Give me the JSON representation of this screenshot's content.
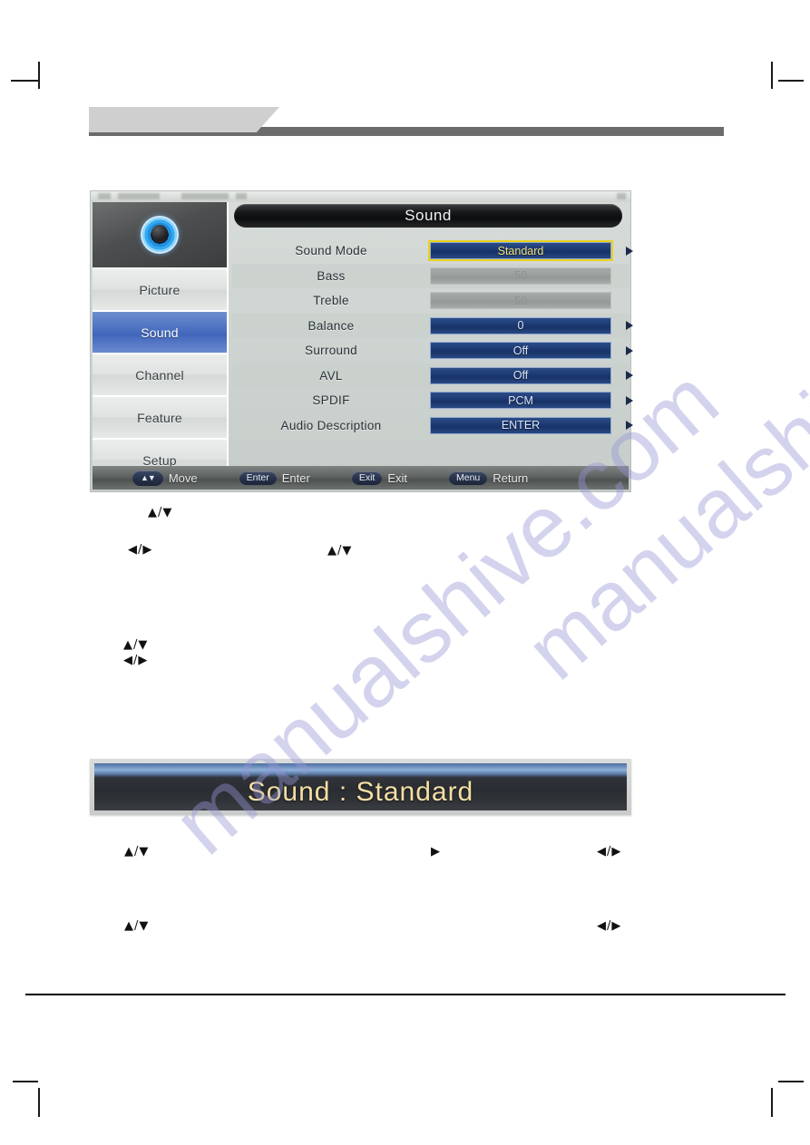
{
  "page": {
    "watermark": "manualshive.com"
  },
  "osd": {
    "title": "Sound",
    "sidebar": {
      "icon": "speaker-ring-icon",
      "items": [
        {
          "label": "Picture",
          "active": false
        },
        {
          "label": "Sound",
          "active": true
        },
        {
          "label": "Channel",
          "active": false
        },
        {
          "label": "Feature",
          "active": false
        },
        {
          "label": "Setup",
          "active": false
        }
      ]
    },
    "rows": [
      {
        "label": "Sound  Mode",
        "value": "Standard",
        "style": "selected",
        "arrow": true
      },
      {
        "label": "Bass",
        "value": "50",
        "style": "disabled",
        "arrow": false
      },
      {
        "label": "Treble",
        "value": "50",
        "style": "disabled",
        "arrow": false
      },
      {
        "label": "Balance",
        "value": "0",
        "style": "normal",
        "arrow": true
      },
      {
        "label": "Surround",
        "value": "Off",
        "style": "normal",
        "arrow": true
      },
      {
        "label": "AVL",
        "value": "Off",
        "style": "normal",
        "arrow": true
      },
      {
        "label": "SPDIF",
        "value": "PCM",
        "style": "normal",
        "arrow": true
      },
      {
        "label": "Audio  Description",
        "value": "ENTER",
        "style": "normal",
        "arrow": true
      }
    ],
    "hints": [
      {
        "key": "▲▼",
        "label": "Move"
      },
      {
        "key": "Enter",
        "label": "Enter"
      },
      {
        "key": "Exit",
        "label": "Exit"
      },
      {
        "key": "Menu",
        "label": "Return"
      }
    ]
  },
  "banner": {
    "text": "Sound  :  Standard"
  },
  "glyphs": {
    "g1": "▲/▼",
    "g2": "◀/▶",
    "g3": "▲/▼",
    "g4": "▲/▼",
    "g5": "◀/▶",
    "g6": "▲/▼",
    "g7": "▶",
    "g8": "◀/▶",
    "g9": "▲/▼",
    "g10": "◀/▶"
  },
  "colors": {
    "accent_blue": "#1d3a74",
    "highlight_yellow": "#e8d21f",
    "banner_text": "#f4dfa4",
    "sidebar_active": "#4a6fc0"
  }
}
